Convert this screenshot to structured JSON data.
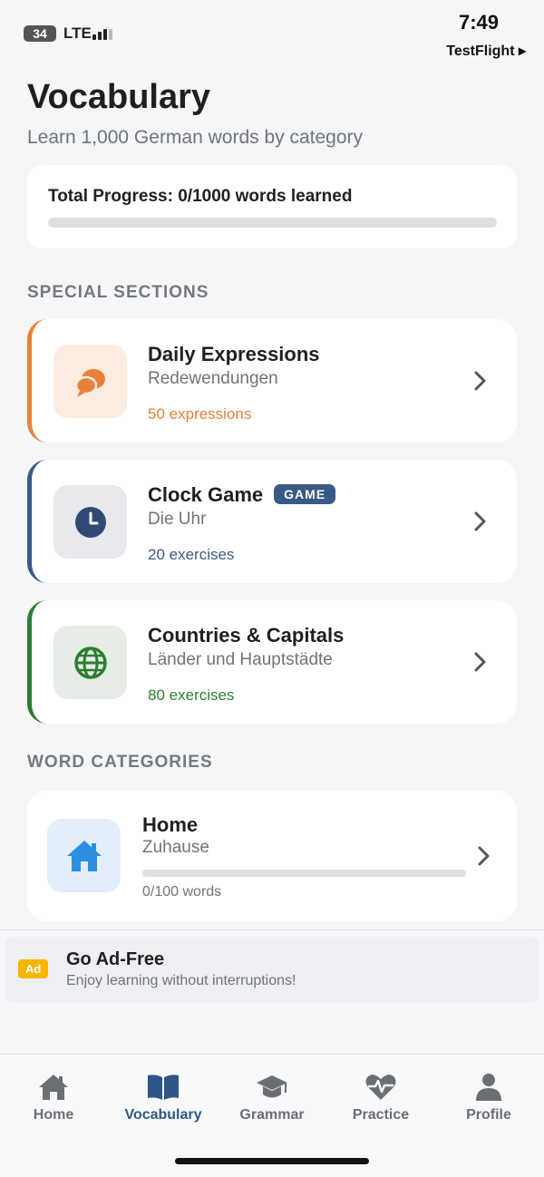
{
  "status_bar": {
    "battery": "34",
    "network": "LTE",
    "time": "7:49",
    "back_app": "TestFlight ▸"
  },
  "header": {
    "title": "Vocabulary",
    "subtitle": "Learn 1,000 German words by category"
  },
  "progress": {
    "label": "Total Progress: 0/1000 words learned",
    "learned": 0,
    "total": 1000
  },
  "special_sections": {
    "title": "SPECIAL SECTIONS",
    "items": [
      {
        "title": "Daily Expressions",
        "subtitle": "Redewendungen",
        "count": "50 expressions",
        "icon": "speech-bubbles-icon",
        "accent": "#e8823a",
        "icon_bg": "#fcebdf"
      },
      {
        "title": "Clock Game",
        "badge": "GAME",
        "subtitle": "Die Uhr",
        "count": "20 exercises",
        "icon": "clock-icon",
        "accent": "#3a5a86",
        "icon_bg": "#e7e9ed"
      },
      {
        "title": "Countries & Capitals",
        "subtitle": "Länder und Hauptstädte",
        "count": "80 exercises",
        "icon": "globe-icon",
        "accent": "#2e7d32",
        "icon_bg": "#e5ede6"
      }
    ]
  },
  "word_categories": {
    "title": "WORD CATEGORIES",
    "items": [
      {
        "title": "Home",
        "subtitle": "Zuhause",
        "count": "0/100 words",
        "progress": 0,
        "icon": "house-icon"
      }
    ]
  },
  "ad": {
    "badge": "Ad",
    "title": "Go Ad-Free",
    "subtitle": "Enjoy learning without interruptions!"
  },
  "tabs": [
    {
      "label": "Home",
      "icon": "home-icon",
      "active": false
    },
    {
      "label": "Vocabulary",
      "icon": "book-icon",
      "active": true
    },
    {
      "label": "Grammar",
      "icon": "graduation-cap-icon",
      "active": false
    },
    {
      "label": "Practice",
      "icon": "heart-pulse-icon",
      "active": false
    },
    {
      "label": "Profile",
      "icon": "person-icon",
      "active": false
    }
  ],
  "colors": {
    "accent_blue": "#2f5686",
    "background": "#f5f6f8",
    "progress_track": "#dedfe1"
  }
}
